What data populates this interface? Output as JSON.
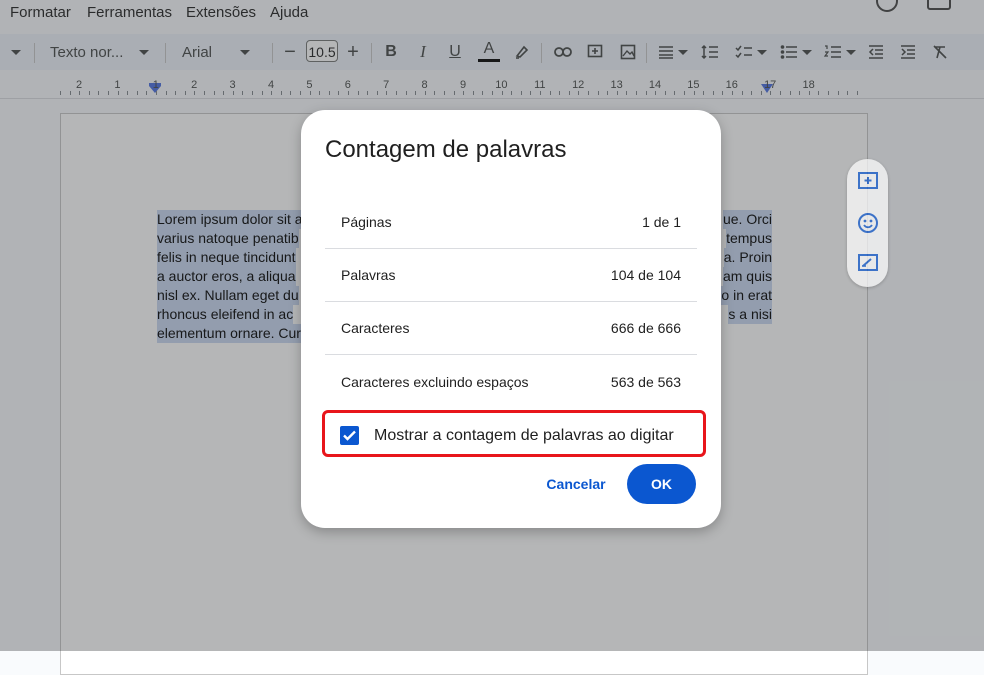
{
  "menu": {
    "items": [
      "Formatar",
      "Ferramentas",
      "Extensões",
      "Ajuda"
    ]
  },
  "toolbar": {
    "style_value": "Texto nor...",
    "font_value": "Arial",
    "font_size": "10.5",
    "minus_symbol": "−",
    "plus_symbol": "+",
    "bold": "B",
    "italic": "I",
    "underline": "U",
    "text_color": "A",
    "text_color_bar": "#000000"
  },
  "ruler": {
    "numbers": [
      "2",
      "1",
      "1",
      "2",
      "3",
      "4",
      "5",
      "6",
      "7",
      "8",
      "9",
      "10",
      "11",
      "12",
      "13",
      "14",
      "15",
      "16",
      "17",
      "18"
    ]
  },
  "document": {
    "lines": [
      "Lorem ipsum dolor sit a",
      "varius natoque penatib",
      "felis in neque tincidunt",
      "a auctor eros, a aliqua",
      "nisl ex. Nullam eget du",
      "rhoncus eleifend in ac",
      "elementum ornare. Cur"
    ],
    "lines_right": [
      "ue. Orci",
      "tempus",
      "a. Proin",
      "am quis",
      "o in erat",
      "s a nisi",
      ""
    ]
  },
  "side_actions": {
    "icons": [
      "add-comment-icon",
      "emoji-icon",
      "suggest-edit-icon"
    ]
  },
  "dialog": {
    "title": "Contagem de palavras",
    "rows": [
      {
        "label": "Páginas",
        "value": "1 de 1"
      },
      {
        "label": "Palavras",
        "value": "104 de 104"
      },
      {
        "label": "Caracteres",
        "value": "666 de 666"
      },
      {
        "label": "Caracteres excluindo espaços",
        "value": "563 de 563"
      }
    ],
    "checkbox_label": "Mostrar a contagem de palavras ao digitar",
    "checkbox_checked": true,
    "cancel_label": "Cancelar",
    "ok_label": "OK",
    "accent_color": "#0b57d0",
    "highlight_color": "#e8151b"
  }
}
